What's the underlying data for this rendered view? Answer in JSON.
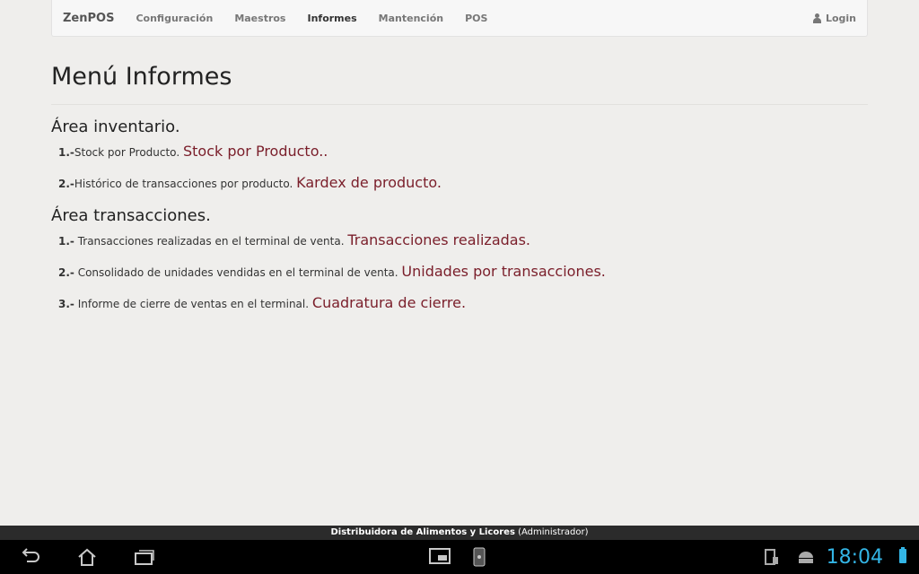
{
  "navbar": {
    "brand": "ZenPOS",
    "items": [
      "Configuración",
      "Maestros",
      "Informes",
      "Mantención",
      "POS"
    ],
    "active": "Informes",
    "login_label": "Login"
  },
  "page": {
    "title": "Menú Informes"
  },
  "sections": [
    {
      "title": "Área inventario.",
      "items": [
        {
          "num": "1.-",
          "desc": "Stock por Producto.",
          "link": "Stock por Producto.."
        },
        {
          "num": "2.-",
          "desc": "Histórico de transacciones por producto.",
          "link": "Kardex de producto."
        }
      ]
    },
    {
      "title": "Área transacciones.",
      "items": [
        {
          "num": "1.-",
          "desc": " Transacciones realizadas en el terminal de venta.",
          "link": "Transacciones realizadas."
        },
        {
          "num": "2.-",
          "desc": " Consolidado de unidades vendidas en el terminal de venta.",
          "link": "Unidades por transacciones."
        },
        {
          "num": "3.-",
          "desc": " Informe de cierre de ventas en el terminal.",
          "link": "Cuadratura de cierre."
        }
      ]
    }
  ],
  "footer": {
    "org": "Distribuidora de Alimentos y Licores",
    "role": "(Administrador)"
  },
  "system": {
    "time": "18:04",
    "icons": [
      "back-icon",
      "home-icon",
      "recent-apps-icon",
      "screenshot-icon",
      "phone-icon",
      "notification-icon",
      "android-icon",
      "battery-icon"
    ]
  },
  "colors": {
    "link": "#7a1e2a",
    "clock": "#33b5e5"
  }
}
